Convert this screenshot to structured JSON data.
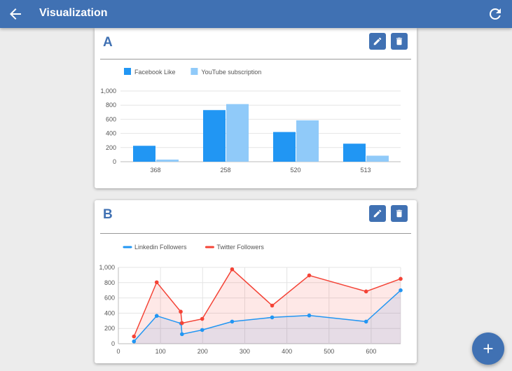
{
  "appbar": {
    "title": "Visualization",
    "back_icon": "arrow-left-icon",
    "refresh_icon": "refresh-icon",
    "color": "#4071b3"
  },
  "cards": [
    {
      "letter": "A",
      "edit_icon": "pencil-icon",
      "delete_icon": "trash-icon"
    },
    {
      "letter": "B",
      "edit_icon": "pencil-icon",
      "delete_icon": "trash-icon"
    }
  ],
  "fab": {
    "icon": "plus-icon"
  },
  "chart_data": [
    {
      "type": "bar",
      "categories": [
        "368",
        "258",
        "520",
        "513"
      ],
      "series": [
        {
          "name": "Facebook Like",
          "values": [
            225,
            730,
            420,
            255
          ],
          "color": "#2196f3"
        },
        {
          "name": "YouTube subscription",
          "values": [
            30,
            815,
            585,
            85
          ],
          "color": "#90caf9"
        }
      ],
      "ylim": [
        0,
        1000
      ],
      "yticks": [
        "0",
        "200",
        "400",
        "600",
        "800",
        "1,000"
      ],
      "legend": "top-left",
      "grid": true
    },
    {
      "type": "area",
      "x_ticks": [
        "0",
        "100",
        "200",
        "300",
        "400",
        "500",
        "600"
      ],
      "xlim": [
        0,
        670
      ],
      "yticks": [
        "0",
        "200",
        "400",
        "600",
        "800",
        "1,000"
      ],
      "ylim": [
        0,
        1000
      ],
      "series": [
        {
          "name": "Linkedin Followers",
          "color": "#2196f3",
          "points": [
            [
              37,
              30
            ],
            [
              91,
              365
            ],
            [
              149,
              265
            ],
            [
              151,
              125
            ],
            [
              199,
              180
            ],
            [
              270,
              290
            ],
            [
              365,
              345
            ],
            [
              453,
              370
            ],
            [
              588,
              290
            ],
            [
              670,
              700
            ]
          ]
        },
        {
          "name": "Twitter Followers",
          "color": "#f44336",
          "points": [
            [
              37,
              95
            ],
            [
              91,
              805
            ],
            [
              148,
              420
            ],
            [
              151,
              270
            ],
            [
              199,
              325
            ],
            [
              270,
              975
            ],
            [
              365,
              500
            ],
            [
              453,
              895
            ],
            [
              588,
              685
            ],
            [
              670,
              850
            ]
          ]
        }
      ],
      "legend": "top-left",
      "grid": true
    }
  ]
}
